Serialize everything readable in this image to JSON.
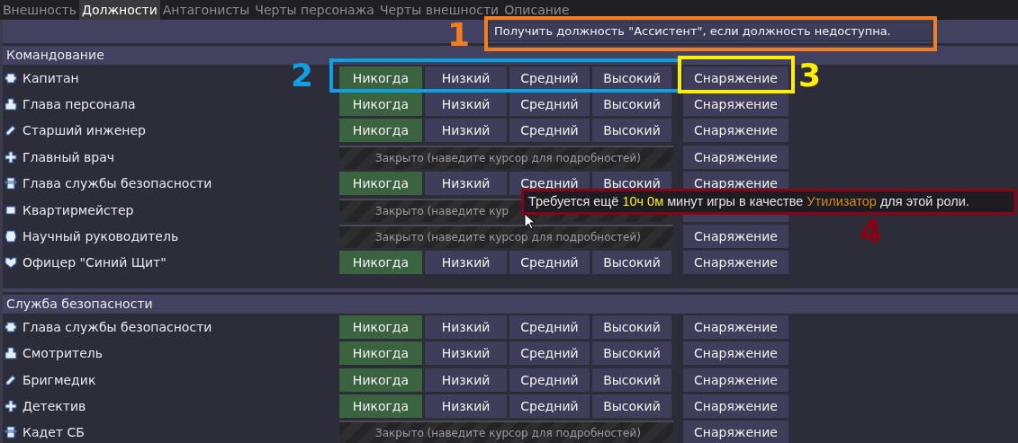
{
  "tabs": [
    {
      "label": "Внешность",
      "selected": false
    },
    {
      "label": "Должности",
      "selected": true
    },
    {
      "label": "Антагонисты",
      "selected": false
    },
    {
      "label": "Черты персонажа",
      "selected": false
    },
    {
      "label": "Черты внешности",
      "selected": false
    },
    {
      "label": "Описание",
      "selected": false
    }
  ],
  "fallback_dropdown": {
    "value": "Получить должность \"Ассистент\", если должность недоступна."
  },
  "sections": [
    {
      "title": "Командование",
      "jobs": [
        {
          "name": "Капитан",
          "kind": "open",
          "levels": [
            {
              "label": "Никогда",
              "selected": true
            },
            {
              "label": "Низкий",
              "selected": false
            },
            {
              "label": "Средний",
              "selected": false
            },
            {
              "label": "Высокий",
              "selected": false
            }
          ],
          "equipment": "Снаряжение"
        },
        {
          "name": "Глава персонала",
          "kind": "open",
          "levels": [
            {
              "label": "Никогда",
              "selected": true
            },
            {
              "label": "Низкий",
              "selected": false
            },
            {
              "label": "Средний",
              "selected": false
            },
            {
              "label": "Высокий",
              "selected": false
            }
          ],
          "equipment": "Снаряжение"
        },
        {
          "name": "Старший инженер",
          "kind": "open",
          "levels": [
            {
              "label": "Никогда",
              "selected": true
            },
            {
              "label": "Низкий",
              "selected": false
            },
            {
              "label": "Средний",
              "selected": false
            },
            {
              "label": "Высокий",
              "selected": false
            }
          ],
          "equipment": "Снаряжение"
        },
        {
          "name": "Главный врач",
          "kind": "locked",
          "locked_text": "Закрыто (наведите курсор для подробностей)",
          "equipment": "Снаряжение"
        },
        {
          "name": "Глава службы безопасности",
          "kind": "open",
          "levels": [
            {
              "label": "Никогда",
              "selected": true
            },
            {
              "label": "Низкий",
              "selected": false
            },
            {
              "label": "Средний",
              "selected": false
            },
            {
              "label": "Высокий",
              "selected": false
            }
          ],
          "equipment": "Снаряжение"
        },
        {
          "name": "Квартирмейстер",
          "kind": "locked",
          "locked_text": "Закрыто (наведите кур"
        },
        {
          "name": "Научный руководитель",
          "kind": "locked",
          "locked_text": "Закрыто (наведите курсор для подробностей)",
          "equipment": "Снаряжение"
        },
        {
          "name": "Офицер \"Синий Щит\"",
          "kind": "open",
          "levels": [
            {
              "label": "Никогда",
              "selected": true
            },
            {
              "label": "Низкий",
              "selected": false
            },
            {
              "label": "Средний",
              "selected": false
            },
            {
              "label": "Высокий",
              "selected": false
            }
          ],
          "equipment": "Снаряжение"
        }
      ]
    },
    {
      "title": "Служба безопасности",
      "jobs": [
        {
          "name": "Глава службы безопасности",
          "kind": "open",
          "levels": [
            {
              "label": "Никогда",
              "selected": true
            },
            {
              "label": "Низкий",
              "selected": false
            },
            {
              "label": "Средний",
              "selected": false
            },
            {
              "label": "Высокий",
              "selected": false
            }
          ],
          "equipment": "Снаряжение"
        },
        {
          "name": "Смотритель",
          "kind": "open",
          "levels": [
            {
              "label": "Никогда",
              "selected": true
            },
            {
              "label": "Низкий",
              "selected": false
            },
            {
              "label": "Средний",
              "selected": false
            },
            {
              "label": "Высокий",
              "selected": false
            }
          ],
          "equipment": "Снаряжение"
        },
        {
          "name": "Бригмедик",
          "kind": "open",
          "levels": [
            {
              "label": "Никогда",
              "selected": true
            },
            {
              "label": "Низкий",
              "selected": false
            },
            {
              "label": "Средний",
              "selected": false
            },
            {
              "label": "Высокий",
              "selected": false
            }
          ],
          "equipment": "Снаряжение"
        },
        {
          "name": "Детектив",
          "kind": "open",
          "levels": [
            {
              "label": "Никогда",
              "selected": true
            },
            {
              "label": "Низкий",
              "selected": false
            },
            {
              "label": "Средний",
              "selected": false
            },
            {
              "label": "Высокий",
              "selected": false
            }
          ],
          "equipment": "Снаряжение"
        },
        {
          "name": "Кадет СБ",
          "kind": "locked",
          "locked_text": "Закрыто (наведите курсор для подробностей)",
          "equipment": "Снаряжение"
        }
      ]
    }
  ],
  "tooltip": {
    "parts": [
      {
        "text": "Требуется ещё ",
        "kind": "plain"
      },
      {
        "text": "10ч 0м",
        "kind": "time"
      },
      {
        "text": " минут игры в качестве ",
        "kind": "plain"
      },
      {
        "text": "Утилизатор",
        "kind": "role"
      },
      {
        "text": " для этой роли.",
        "kind": "plain"
      }
    ]
  },
  "annotations": [
    {
      "number": "1",
      "color": "#f47d20"
    },
    {
      "number": "2",
      "color": "#0ea0e0"
    },
    {
      "number": "3",
      "color": "#ffee00"
    },
    {
      "number": "4",
      "color": "#8b0014"
    }
  ]
}
